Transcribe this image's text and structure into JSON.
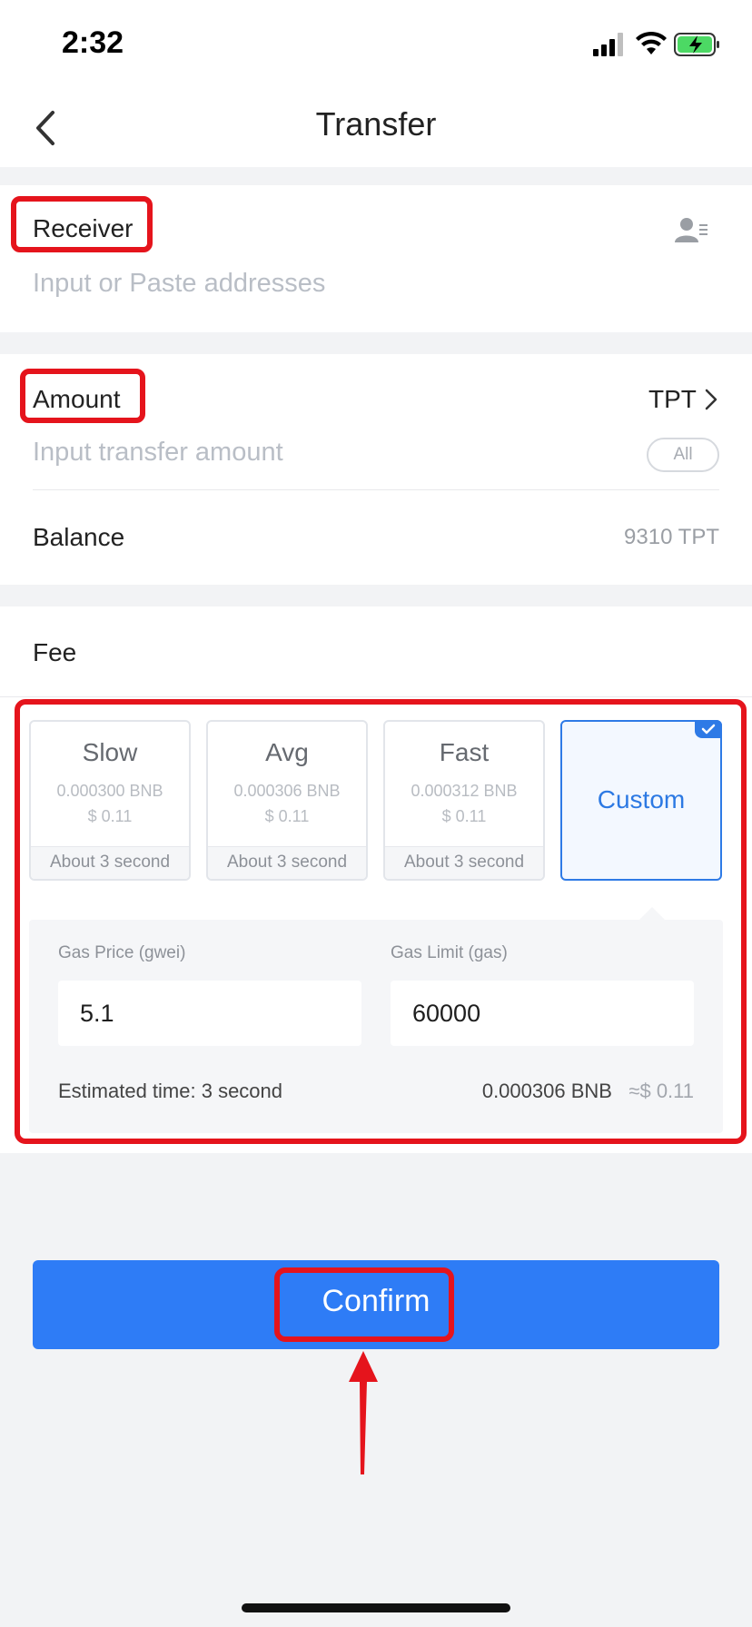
{
  "status_bar": {
    "time": "2:32"
  },
  "nav": {
    "title": "Transfer",
    "back_icon": "chevron-left-icon"
  },
  "receiver": {
    "label": "Receiver",
    "placeholder": "Input or Paste addresses",
    "contact_icon": "address-book-icon"
  },
  "amount": {
    "label": "Amount",
    "token": "TPT",
    "placeholder": "Input transfer amount",
    "all_label": "All",
    "balance_label": "Balance",
    "balance_value": "9310 TPT"
  },
  "fee": {
    "label": "Fee",
    "options": [
      {
        "name": "Slow",
        "bnb": "0.000300 BNB",
        "usd": "$ 0.11",
        "time": "About 3 second"
      },
      {
        "name": "Avg",
        "bnb": "0.000306 BNB",
        "usd": "$ 0.11",
        "time": "About 3 second"
      },
      {
        "name": "Fast",
        "bnb": "0.000312 BNB",
        "usd": "$ 0.11",
        "time": "About 3 second"
      }
    ],
    "custom": {
      "name": "Custom",
      "selected": true
    },
    "gas_price_label": "Gas Price (gwei)",
    "gas_price_value": "5.1",
    "gas_limit_label": "Gas Limit (gas)",
    "gas_limit_value": "60000",
    "estimated_time": "Estimated time: 3 second",
    "estimated_bnb": "0.000306 BNB",
    "estimated_usd": "≈$ 0.11"
  },
  "confirm": {
    "label": "Confirm"
  },
  "colors": {
    "accent": "#2e7cf6",
    "highlight": "#e5141c",
    "background": "#f2f3f5"
  }
}
